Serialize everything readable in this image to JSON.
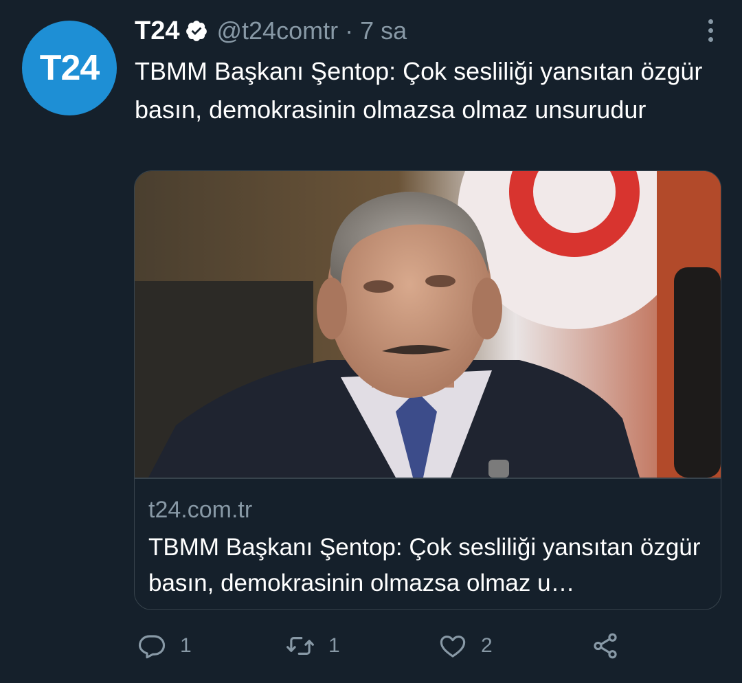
{
  "author": {
    "avatar_text": "T24",
    "name": "T24",
    "handle": "@t24comtr",
    "separator": "·",
    "time": "7 sa",
    "verified_icon": "verified-badge-icon"
  },
  "tweet": {
    "text": "TBMM Başkanı Şentop: Çok sesliliği yansıtan özgür basın, demokrasinin olmazsa olmaz unsurudur"
  },
  "card": {
    "domain": "t24.com.tr",
    "title": "TBMM Başkanı Şentop: Çok sesliliği yansıtan özgür basın, demokrasinin olmazsa olmaz u…"
  },
  "actions": {
    "reply": {
      "icon": "reply-icon",
      "count": "1"
    },
    "retweet": {
      "icon": "retweet-icon",
      "count": "1"
    },
    "like": {
      "icon": "heart-icon",
      "count": "2"
    },
    "share": {
      "icon": "share-icon"
    }
  },
  "colors": {
    "background": "#15202b",
    "secondary_text": "#8899a6",
    "border": "#38444d",
    "avatar_blue": "#1e8fd5"
  }
}
